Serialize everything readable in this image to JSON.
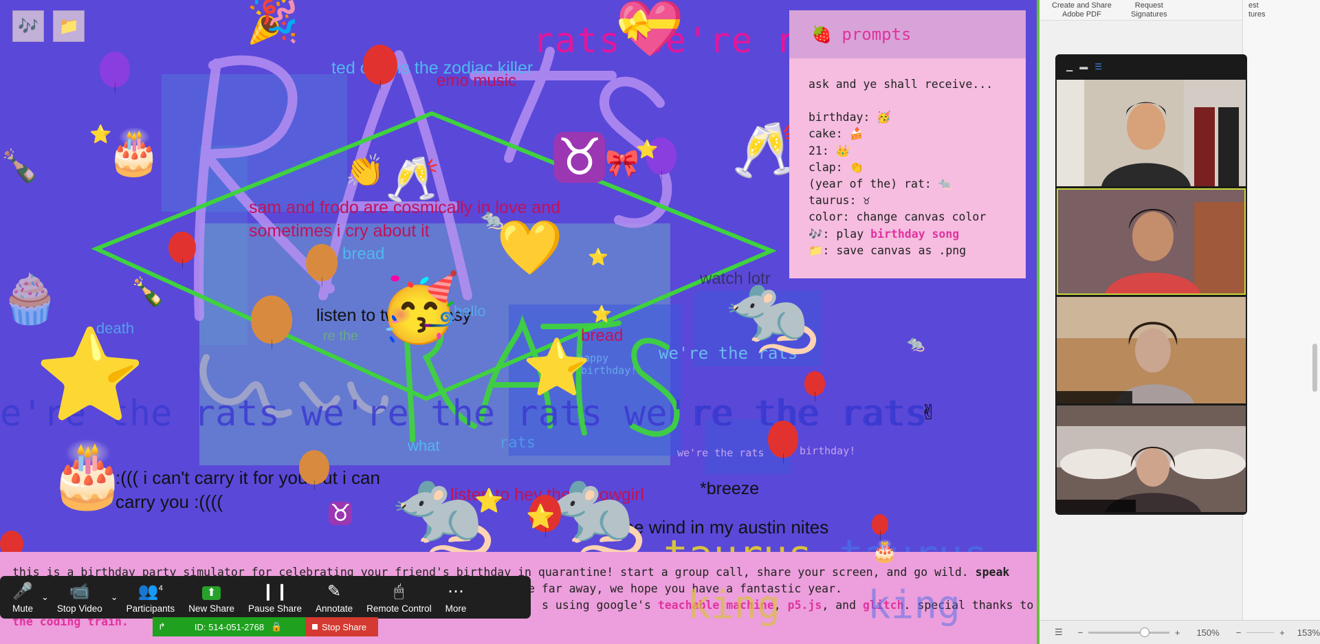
{
  "canvas": {
    "bg_color": "#5a48d8",
    "tool_buttons": [
      {
        "name": "music-note-icon",
        "glyph": "🎶"
      },
      {
        "name": "folder-icon",
        "glyph": "📁"
      }
    ],
    "big_title": "rats we're rats",
    "texts": {
      "zodiac": "ted cruz is the zodiac killer",
      "emo": "emo music",
      "sam": "sam and frodo are cosmically in love and",
      "sam2": "sometimes i cry about it",
      "bread1": "bread",
      "twin": "listen to twin fantasy",
      "hello": "hello",
      "bread2": "bread",
      "weretherats": "we're the rats",
      "death": "death",
      "watchlotr": "watch lotr",
      "carry1": ":((( i can't carry it for you but i can",
      "carry2": "carry you :((((",
      "cowgirl": "listen to hey there cowgirl",
      "breeze": "*breeze",
      "austin": "ur the wind in my austin nites",
      "what": "what",
      "rats_small": "rats",
      "happy": "happy",
      "bday": "birthday!",
      "re_the": "re the",
      "band_text": "e're the rats we're the rats we're the rats",
      "band_text2": "re the rats",
      "taurus": "taurus",
      "taurus2": "taurus",
      "king": "king",
      "king2": "king",
      "small_rats": "we're the rats",
      "small_bday": "birthday!"
    },
    "emoji": {
      "party": "🎉",
      "heart": "💝",
      "cake": "🎂",
      "cheers": "🥂",
      "clap": "👏",
      "taurus": "♉",
      "rat": "🐀",
      "grin": "🥳",
      "heart2": "💛",
      "peace": "✌",
      "bottle": "🍾",
      "star": "⭐",
      "balloon": "🎈",
      "cupcake": "🧁",
      "bow": "🎀"
    }
  },
  "prompts": {
    "title": "🍓 prompts",
    "intro": "ask and ye shall receive...",
    "lines": [
      "birthday: 🥳",
      "cake: 🍰",
      "21: 👑",
      "clap: 👏",
      "(year of the) rat: 🐀",
      "taurus: ♉",
      "color: change canvas color"
    ],
    "song_prefix": "🎶: play ",
    "song_hl": "birthday song",
    "save_line": "📁: save canvas as .png"
  },
  "description": {
    "part1": "this is a birthday party simulator for celebrating your friend's birthday in quarantine! start a group call, share your screen, and go wild. ",
    "bold1": "speak",
    "line2_tail": "e far away, we hope you have a fantastic year.",
    "line3_head": "s using google's ",
    "link1": "teachable machine",
    "sep1": ", ",
    "link2": "p5.js",
    "sep2": ", and ",
    "link3": "glitch",
    "line3_tail": ". special thanks to",
    "link4": "the coding train."
  },
  "zoom_toolbar": {
    "mute": "Mute",
    "stop_video": "Stop Video",
    "participants": "Participants",
    "participants_count": "4",
    "new_share": "New Share",
    "pause_share": "Pause Share",
    "annotate": "Annotate",
    "remote_control": "Remote Control",
    "more": "More",
    "meeting_id": "ID: 514-051-2768",
    "stop_share": "Stop Share"
  },
  "right_app": {
    "tool1": "Create and Share\nAdobe PDF",
    "tool2": "Request\nSignatures",
    "tool3": "est\ntures",
    "zoom_level_1": "150%",
    "zoom_level_2": "153%"
  },
  "gallery": {
    "tiles": [
      {
        "name": "participant-1",
        "bg": "#cfc5b7",
        "face": "#d7a27a",
        "shirt": "#2a2a2a"
      },
      {
        "name": "participant-2",
        "bg": "#7a5f63",
        "face": "#c48d6c",
        "shirt": "#d84646"
      },
      {
        "name": "participant-3",
        "bg": "#b88a5c",
        "face": "#caa58f",
        "shirt": "#a99c9c"
      },
      {
        "name": "participant-4",
        "bg": "#6f5e58",
        "face": "#cfa48d",
        "shirt": "#3a3032"
      }
    ]
  }
}
